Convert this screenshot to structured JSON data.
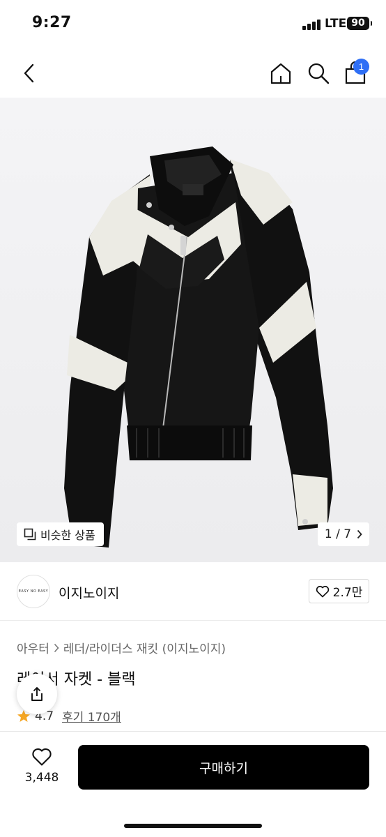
{
  "status_bar": {
    "time": "9:27",
    "network": "LTE",
    "battery": "90"
  },
  "nav": {
    "back_icon": "chevron-left-icon",
    "home_icon": "home-icon",
    "search_icon": "search-icon",
    "cart_icon": "shopping-bag-icon",
    "cart_badge": "1",
    "badge_color": "#2f6ff5"
  },
  "gallery": {
    "similar_label": "비슷한 상품",
    "page_indicator": "1 / 7"
  },
  "brand": {
    "logo_text": "EASY NO EASY",
    "name": "이지노이지",
    "likes": "2.7만"
  },
  "product": {
    "breadcrumb": [
      "아우터",
      "레더/라이더스 재킷 (이지노이지)"
    ],
    "title": "레이서 자켓 - 블랙",
    "rating": "4.7",
    "reviews": "후기 170개"
  },
  "bottom_bar": {
    "wish_count": "3,448",
    "buy_label": "구매하기",
    "buy_color": "#000000"
  }
}
